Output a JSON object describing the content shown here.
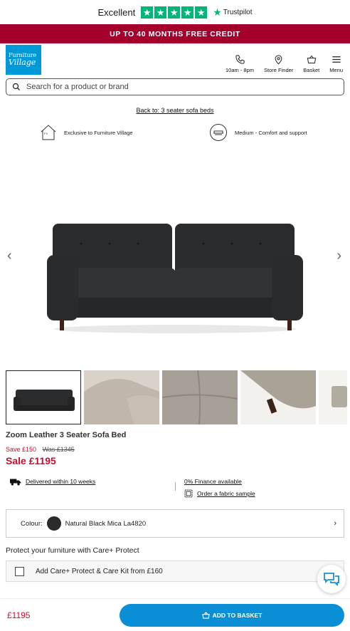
{
  "trustpilot": {
    "rating_text": "Excellent",
    "stars": 5,
    "brand": "Trustpilot",
    "color": "#00b67a"
  },
  "promo": {
    "text": "UP TO 40 MONTHS FREE CREDIT",
    "color": "#a5002d"
  },
  "logo": {
    "line1": "Furniture",
    "line2": "Village",
    "color": "#0099d8"
  },
  "nav": {
    "hours": "10am - 8pm",
    "store_finder": "Store Finder",
    "basket": "Basket",
    "menu": "Menu"
  },
  "search": {
    "placeholder": "Search for a product or brand"
  },
  "breadcrumb": {
    "back_link": "Back to: 3 seater sofa beds"
  },
  "features": {
    "exclusive": "Exclusive to Furniture Village",
    "comfort": "Medium - Comfort and support"
  },
  "product": {
    "name": "Zoom Leather 3 Seater Sofa Bed",
    "save": "Save £150",
    "was": "Was £1345",
    "sale_price": "Sale £1195",
    "sale_color": "#c8102e"
  },
  "delivery": {
    "delivered": "Delivered within 10 weeks",
    "finance": "0% Finance available",
    "sample": "Order a fabric sample"
  },
  "colour": {
    "label": "Colour:",
    "value": "Natural Black Mica La4820",
    "swatch": "#2b2b2b"
  },
  "care": {
    "title": "Protect your furniture with Care+ Protect",
    "option": "Add Care+ Protect & Care Kit from £160"
  },
  "bottom": {
    "price": "£1195",
    "add_to_basket": "ADD TO BASKET",
    "button_color": "#0a8fd6"
  }
}
